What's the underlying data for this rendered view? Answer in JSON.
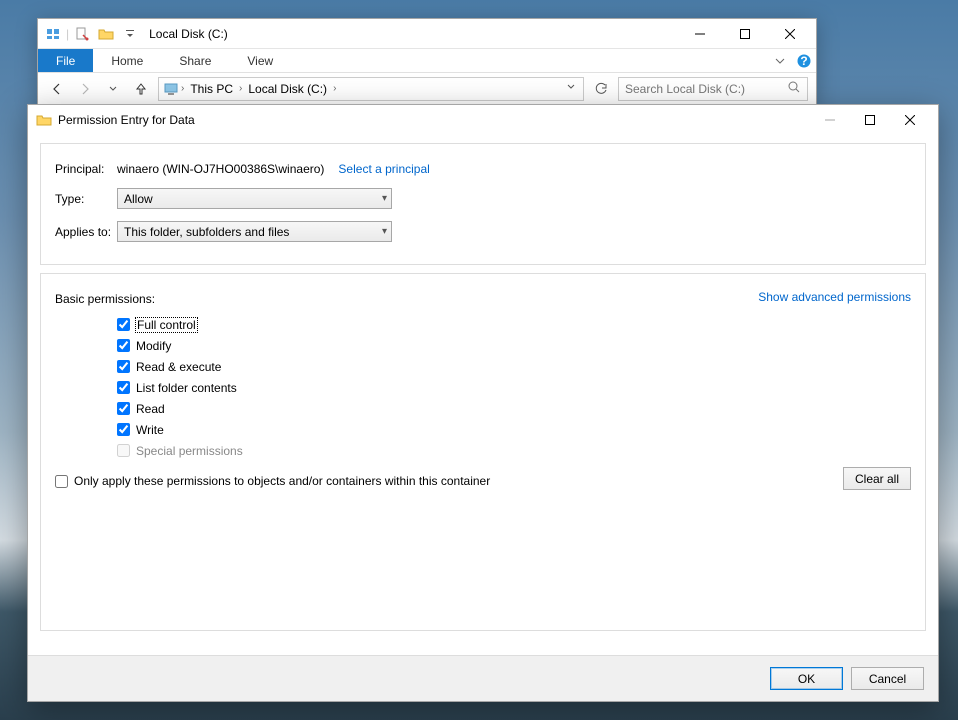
{
  "explorer": {
    "title": "Local Disk (C:)",
    "tabs": {
      "file": "File",
      "home": "Home",
      "share": "Share",
      "view": "View"
    },
    "breadcrumb": {
      "root": "This PC",
      "current": "Local Disk (C:)"
    },
    "search_placeholder": "Search Local Disk (C:)"
  },
  "dialog": {
    "title": "Permission Entry for Data",
    "principal_label": "Principal:",
    "principal_value": "winaero (WIN-OJ7HO00386S\\winaero)",
    "select_principal": "Select a principal",
    "type_label": "Type:",
    "type_value": "Allow",
    "applies_label": "Applies to:",
    "applies_value": "This folder, subfolders and files",
    "basic_perms_label": "Basic permissions:",
    "show_advanced": "Show advanced permissions",
    "permissions": [
      {
        "label": "Full control",
        "checked": true,
        "enabled": true,
        "focused": true
      },
      {
        "label": "Modify",
        "checked": true,
        "enabled": true,
        "focused": false
      },
      {
        "label": "Read & execute",
        "checked": true,
        "enabled": true,
        "focused": false
      },
      {
        "label": "List folder contents",
        "checked": true,
        "enabled": true,
        "focused": false
      },
      {
        "label": "Read",
        "checked": true,
        "enabled": true,
        "focused": false
      },
      {
        "label": "Write",
        "checked": true,
        "enabled": true,
        "focused": false
      },
      {
        "label": "Special permissions",
        "checked": false,
        "enabled": false,
        "focused": false
      }
    ],
    "only_apply_label": "Only apply these permissions to objects and/or containers within this container",
    "only_apply_checked": false,
    "clear_all": "Clear all",
    "ok": "OK",
    "cancel": "Cancel"
  }
}
